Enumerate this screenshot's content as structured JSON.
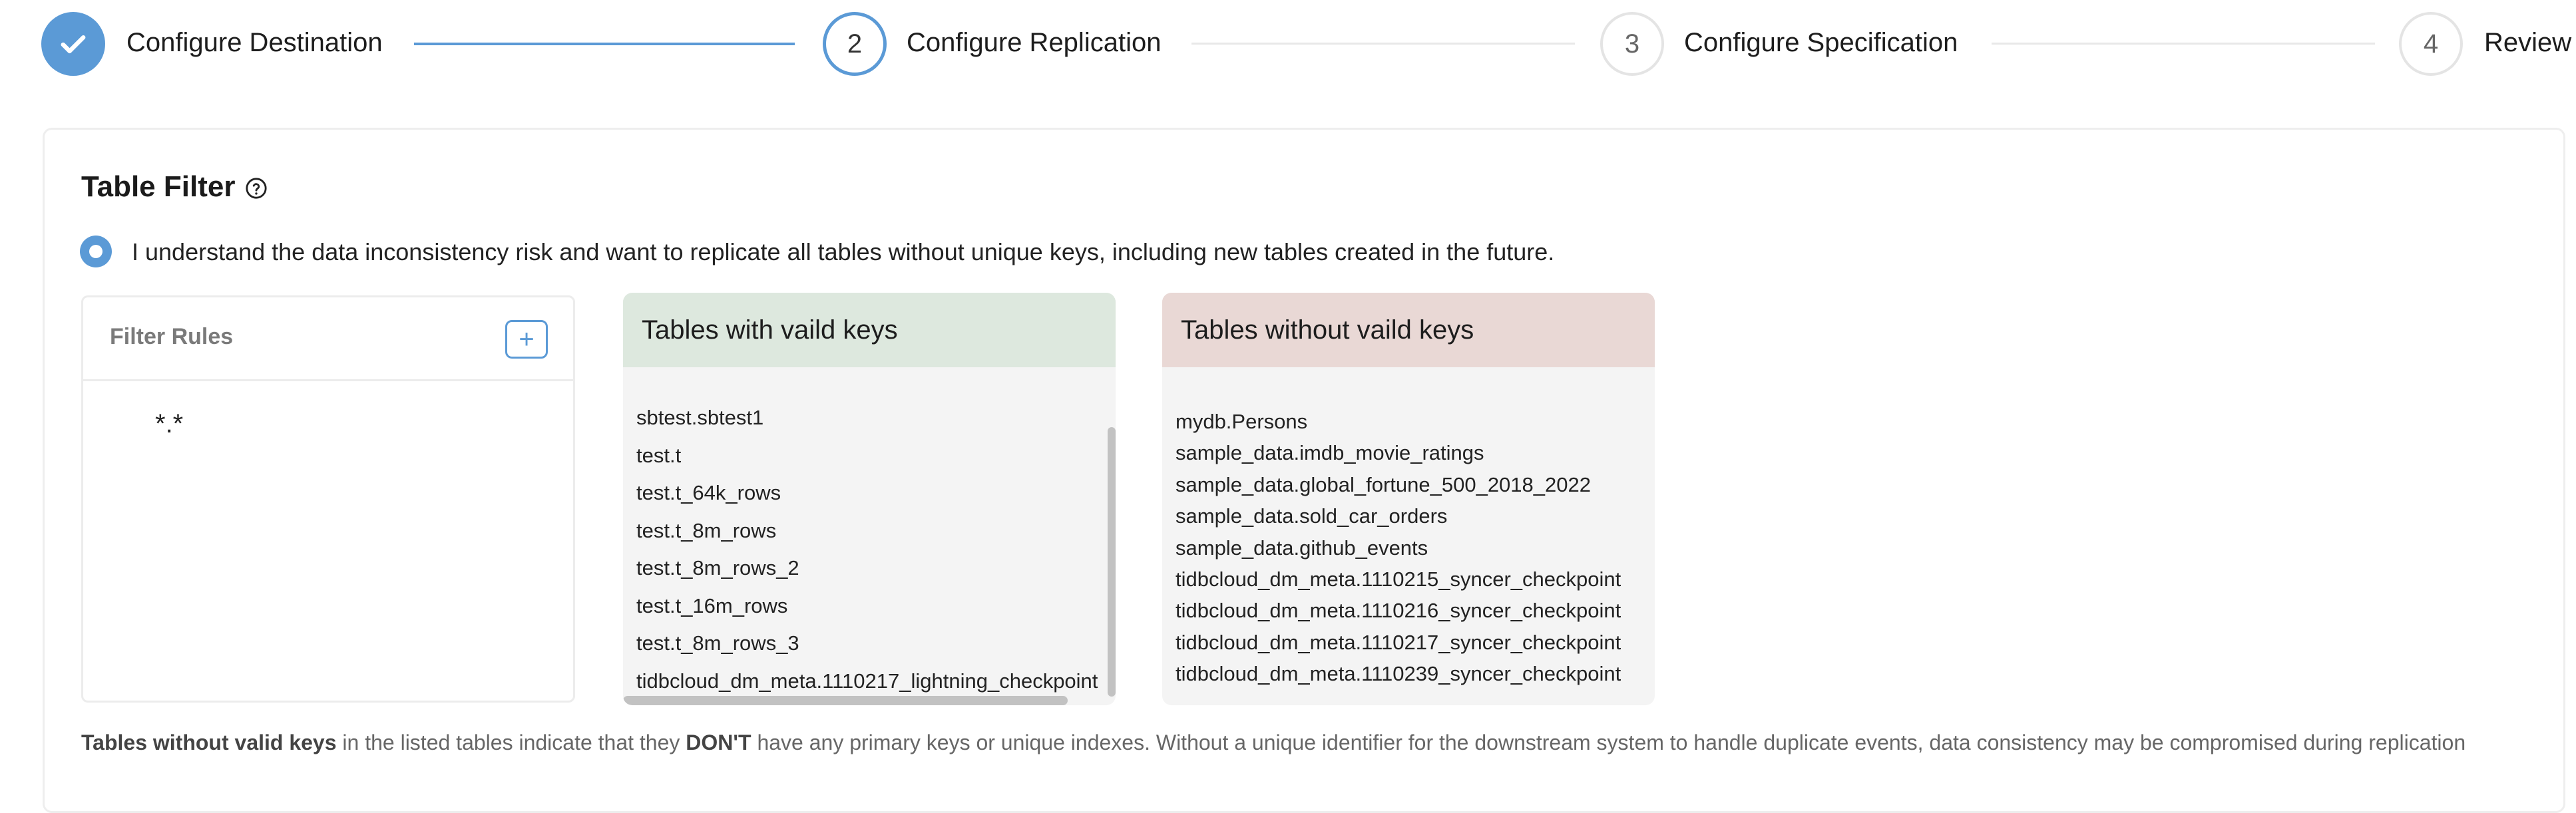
{
  "stepper": {
    "steps": [
      {
        "number": "",
        "label": "Configure Destination",
        "state": "done"
      },
      {
        "number": "2",
        "label": "Configure Replication",
        "state": "active"
      },
      {
        "number": "3",
        "label": "Configure Specification",
        "state": "idle"
      },
      {
        "number": "4",
        "label": "Review",
        "state": "idle"
      }
    ]
  },
  "table_filter": {
    "title": "Table Filter",
    "risk_ack": "I understand the data inconsistency risk and want to replicate all tables without unique keys, including new tables created in the future.",
    "rules_title": "Filter Rules",
    "add_symbol": "+",
    "rules": [
      "*.*"
    ]
  },
  "valid_tables": {
    "title": "Tables with vaild keys",
    "items": [
      "sbtest.sbtest1",
      "test.t",
      "test.t_64k_rows",
      "test.t_8m_rows",
      "test.t_8m_rows_2",
      "test.t_16m_rows",
      "test.t_8m_rows_3",
      "tidbcloud_dm_meta.1110217_lightning_checkpoint"
    ]
  },
  "invalid_tables": {
    "title": "Tables without vaild keys",
    "items": [
      "mydb.Persons",
      "sample_data.imdb_movie_ratings",
      "sample_data.global_fortune_500_2018_2022",
      "sample_data.sold_car_orders",
      "sample_data.github_events",
      "tidbcloud_dm_meta.1110215_syncer_checkpoint",
      "tidbcloud_dm_meta.1110216_syncer_checkpoint",
      "tidbcloud_dm_meta.1110217_syncer_checkpoint",
      "tidbcloud_dm_meta.1110239_syncer_checkpoint"
    ]
  },
  "footnote": {
    "bold1": "Tables without valid keys",
    "text1": " in the listed tables indicate that they ",
    "bold2": "DON'T",
    "text2": " have any primary keys or unique indexes. Without a unique identifier for the downstream system to handle duplicate events, data consistency may be compromised during replication"
  },
  "colors": {
    "accent": "#5b9ad6",
    "valid_header": "#dde8de",
    "invalid_header": "#e9d8d5"
  }
}
